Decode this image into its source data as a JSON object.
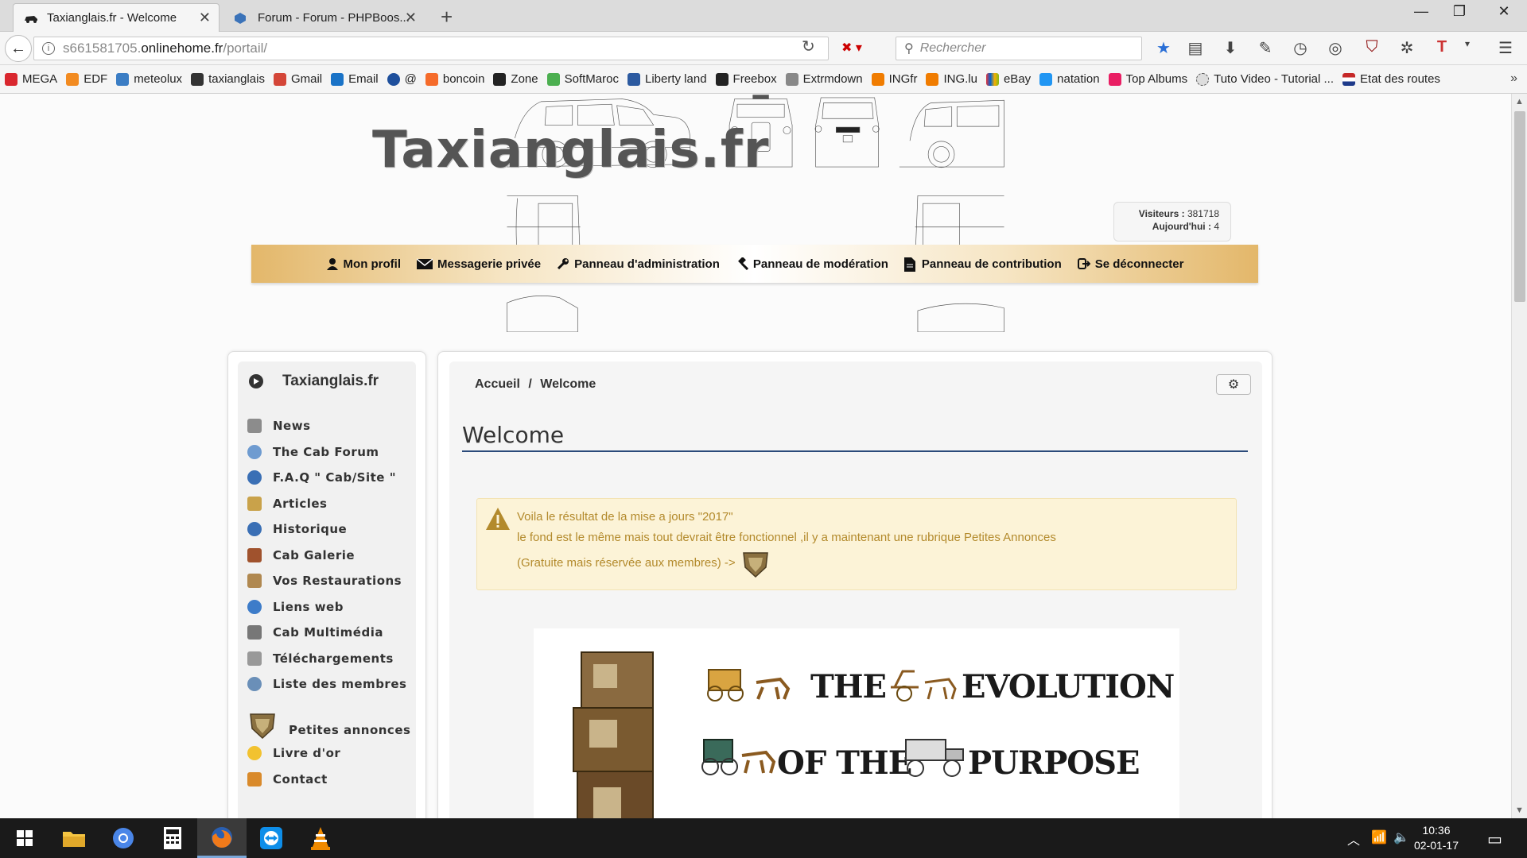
{
  "browser": {
    "tabs": [
      {
        "label": "Taxianglais.fr - Welcome",
        "active": true
      },
      {
        "label": "Forum - Forum - PHPBoos...",
        "active": false
      }
    ],
    "url_dim": "s661581705.",
    "url_host": "onlinehome.fr",
    "url_path": "/portail/",
    "search_placeholder": "Rechercher"
  },
  "bookmarks": [
    {
      "label": "MEGA",
      "color": "#d9272e"
    },
    {
      "label": "EDF",
      "color": "#f28b21"
    },
    {
      "label": "meteolux",
      "color": "#3b7dc4"
    },
    {
      "label": "taxianglais",
      "color": "#333333"
    },
    {
      "label": "Gmail",
      "color": "#d44638"
    },
    {
      "label": "Email",
      "color": "#1a73c7"
    },
    {
      "label": "@",
      "color": "#1e4f9c"
    },
    {
      "label": "boncoin",
      "color": "#f56b2a"
    },
    {
      "label": "Zone",
      "color": "#222222"
    },
    {
      "label": "SoftMaroc",
      "color": "#4caf50"
    },
    {
      "label": "Liberty land",
      "color": "#2c5aa0"
    },
    {
      "label": "Freebox",
      "color": "#222222"
    },
    {
      "label": "Extrmdown",
      "color": "#888888"
    },
    {
      "label": "INGfr",
      "color": "#f07c00"
    },
    {
      "label": "ING.lu",
      "color": "#f07c00"
    },
    {
      "label": "eBay",
      "color": "#e53238"
    },
    {
      "label": "natation",
      "color": "#2196f3"
    },
    {
      "label": "Top Albums",
      "color": "#e91e63"
    },
    {
      "label": "Tuto Video - Tutorial ...",
      "color": "#555555"
    },
    {
      "label": "Etat des routes",
      "color": "#c62828"
    }
  ],
  "site": {
    "title": "Taxianglais.fr",
    "stats_visitors_label": "Visiteurs :",
    "stats_visitors": "381718",
    "stats_today_label": "Aujourd'hui :",
    "stats_today": "4"
  },
  "usernav": [
    {
      "label": "Mon profil",
      "icon": "user-icon"
    },
    {
      "label": "Messagerie privée",
      "icon": "envelope-icon"
    },
    {
      "label": "Panneau d'administration",
      "icon": "wrench-icon"
    },
    {
      "label": "Panneau de modération",
      "icon": "gavel-icon"
    },
    {
      "label": "Panneau de contribution",
      "icon": "document-icon"
    },
    {
      "label": "Se déconnecter",
      "icon": "logout-icon"
    }
  ],
  "sidebar": {
    "title": "Taxianglais.fr",
    "items": [
      {
        "label": "News",
        "color": "#8c8c8c"
      },
      {
        "label": "The Cab Forum",
        "color": "#6e9bd0"
      },
      {
        "label": "F.A.Q \" Cab/Site \"",
        "color": "#3a6fb5"
      },
      {
        "label": "Articles",
        "color": "#c9a24a"
      },
      {
        "label": "Historique",
        "color": "#3a6fb5"
      },
      {
        "label": "Cab Galerie",
        "color": "#a0522d"
      },
      {
        "label": "Vos Restaurations",
        "color": "#b08850"
      },
      {
        "label": "Liens web",
        "color": "#3d7cc9"
      },
      {
        "label": "Cab Multimédia",
        "color": "#777777"
      },
      {
        "label": "Téléchargements",
        "color": "#999999"
      },
      {
        "label": "Liste des membres",
        "color": "#6a8fb8"
      },
      {
        "label": "Petites annonces",
        "color": "#a08040"
      },
      {
        "label": "Livre d'or",
        "color": "#f2c230"
      },
      {
        "label": "Contact",
        "color": "#d98a2b"
      }
    ]
  },
  "main": {
    "breadcrumb_home": "Accueil",
    "breadcrumb_sep": "/",
    "breadcrumb_current": "Welcome",
    "title": "Welcome",
    "alert_line1": "Voila le résultat de la mise a jours \"2017\"",
    "alert_line2": "le fond est le même mais tout devrait être fonctionnel ,il y a maintenant une rubrique Petites Annonces",
    "alert_line3": "(Gratuite mais réservée aux membres) ->",
    "evolution": {
      "word1": "THE",
      "word2": "EVOLUTION",
      "word3": "OF THE",
      "word4": "PURPOSE"
    }
  },
  "taskbar": {
    "time": "10:36",
    "date": "02-01-17"
  }
}
